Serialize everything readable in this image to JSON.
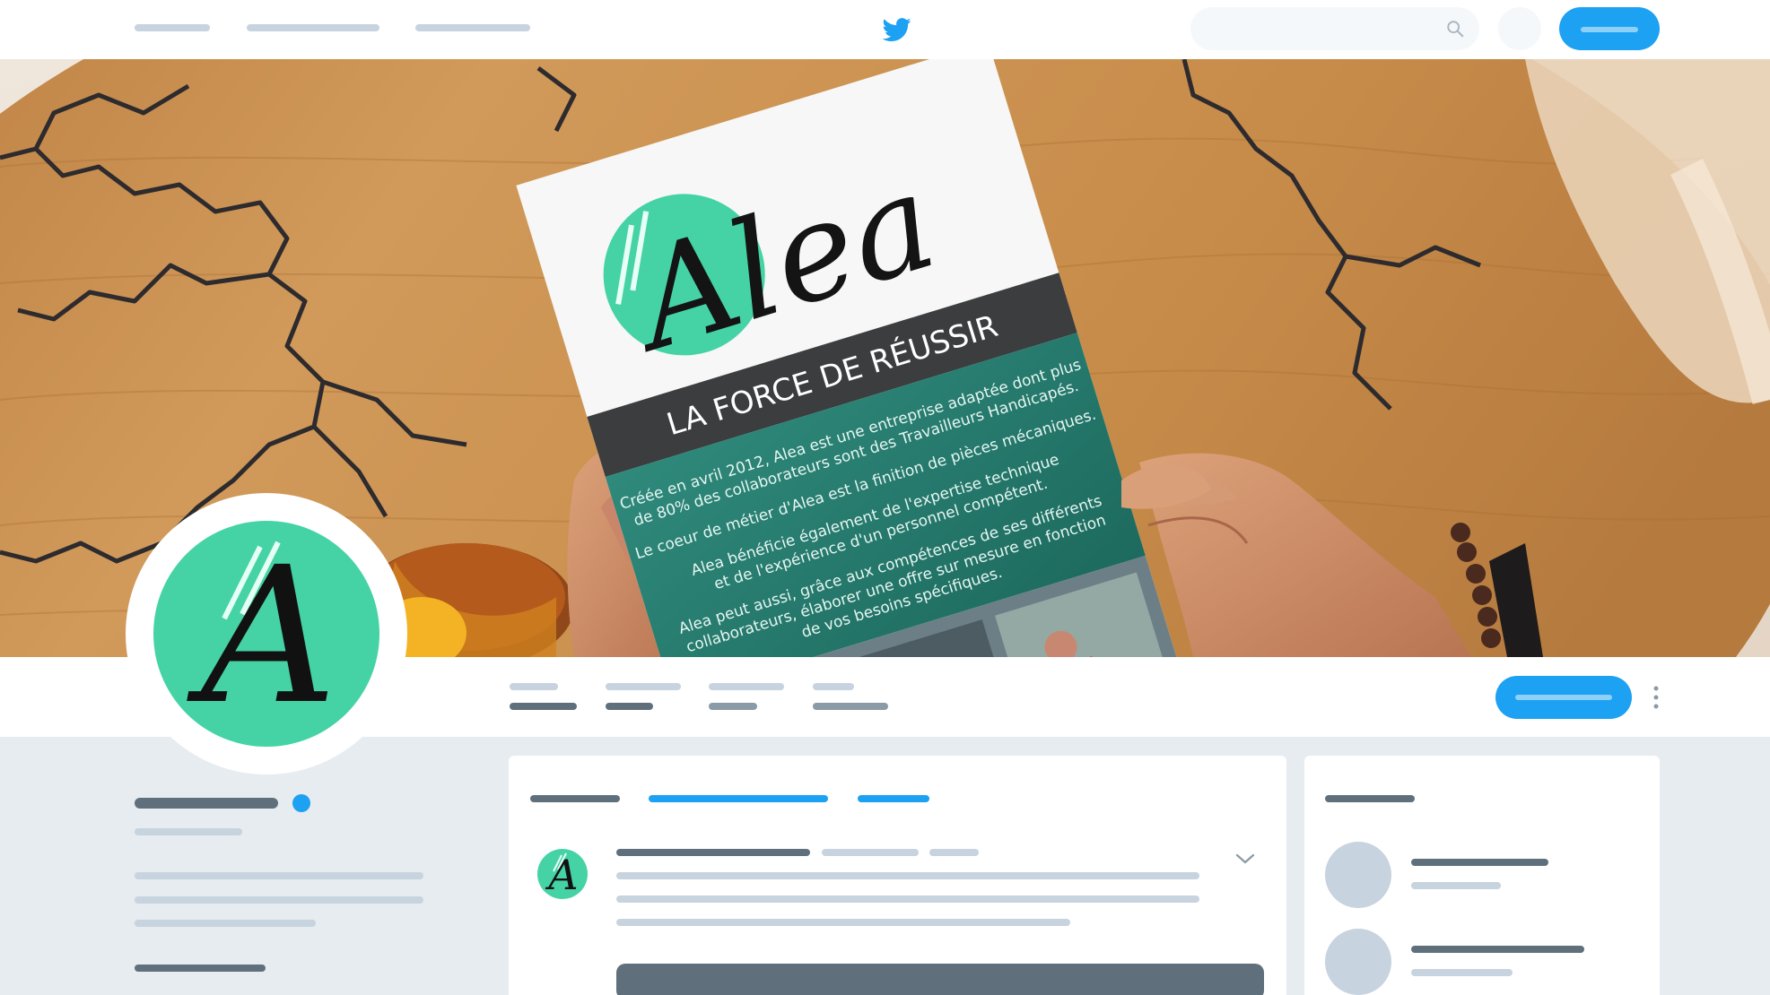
{
  "app": {
    "name": "Twitter profile mockup"
  },
  "icons": {
    "brand": "twitter-bird-icon",
    "search": "search-icon",
    "more": "more-vertical-icon",
    "chevron": "chevron-down-icon"
  },
  "colors": {
    "twitter_blue": "#1da1f2",
    "brand_green": "#45d3a6",
    "brand_teal": "#2b8074",
    "page_bg": "#e6ecf0",
    "placeholder_light": "#c7d3de",
    "placeholder_dark": "#5f707c"
  },
  "banner": {
    "brochure": {
      "logo_text": "Alea",
      "tagline": "LA FORCE DE RÉUSSIR",
      "paragraphs": [
        "Créée en avril 2012, Alea est une entreprise adaptée dont plus",
        "de 80% des collaborateurs sont des Travailleurs Handicapés.",
        "Le coeur de métier d'Alea est la finition de pièces mécaniques.",
        "Alea bénéficie également de l'expertise technique",
        "et de l'expérience d'un personnel compétent.",
        "Alea peut aussi, grâce aux compétences de ses différents",
        "collaborateurs, élaborer une offre sur mesure en fonction",
        "de vos besoins spécifiques."
      ]
    }
  },
  "profile": {
    "avatar_letter": "A",
    "tweet_avatar_letter": "A"
  }
}
